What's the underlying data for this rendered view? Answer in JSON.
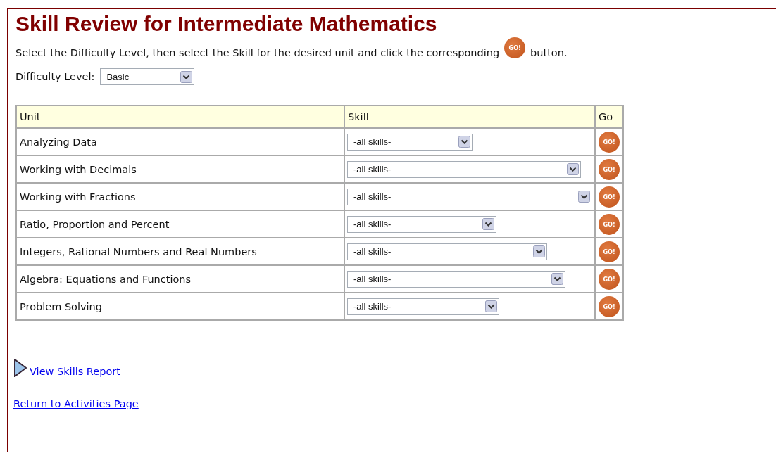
{
  "title": "Skill Review for Intermediate Mathematics",
  "instructions": {
    "before": "Select the Difficulty Level, then select the Skill for the desired unit and click the corresponding",
    "go_label": "GO!",
    "after": "button."
  },
  "difficulty": {
    "label": "Difficulty Level:",
    "value": "Basic"
  },
  "table": {
    "columns": [
      "Unit",
      "Skill",
      "Go"
    ],
    "rows": [
      {
        "unit": "Analyzing Data",
        "skill": "-all skills-",
        "go": "GO!"
      },
      {
        "unit": "Working with Decimals",
        "skill": "-all skills-",
        "go": "GO!"
      },
      {
        "unit": "Working with Fractions",
        "skill": "-all skills-",
        "go": "GO!"
      },
      {
        "unit": "Ratio, Proportion and Percent",
        "skill": "-all skills-",
        "go": "GO!"
      },
      {
        "unit": "Integers, Rational Numbers and Real Numbers",
        "skill": "-all skills-",
        "go": "GO!"
      },
      {
        "unit": "Algebra: Equations and Functions",
        "skill": "-all skills-",
        "go": "GO!"
      },
      {
        "unit": "Problem Solving",
        "skill": "-all skills-",
        "go": "GO!"
      }
    ]
  },
  "links": {
    "report": "View Skills Report",
    "return": "Return to Activities Page"
  }
}
